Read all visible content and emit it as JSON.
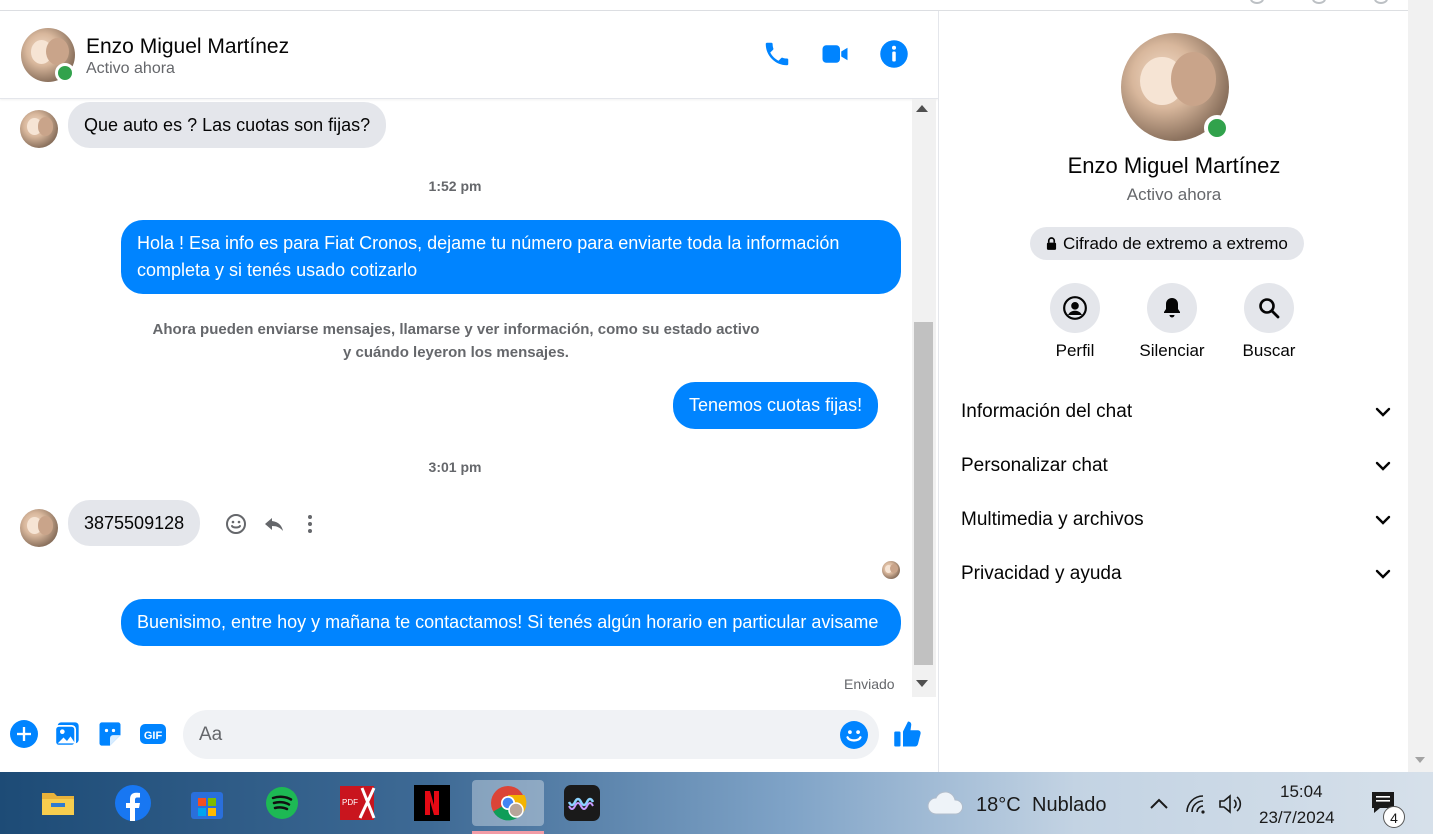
{
  "header": {
    "contact_name": "Enzo Miguel Martínez",
    "status": "Activo ahora"
  },
  "messages": {
    "incoming_1": "Que auto es ? Las cuotas son fijas?",
    "time_1": "1:52 pm",
    "outgoing_1": "Hola ! Esa info es para Fiat Cronos, dejame tu número para enviarte toda la información completa y si tenés usado cotizarlo",
    "notice_line_1": "Ahora pueden enviarse mensajes, llamarse y ver información, como su estado activo",
    "notice_line_2": "y cuándo leyeron los mensajes.",
    "outgoing_2": "Tenemos cuotas fijas!",
    "time_2": "3:01 pm",
    "incoming_2": "3875509128",
    "outgoing_3": "Buenisimo, entre hoy y mañana te contactamos! Si tenés algún horario en particular avisame",
    "sent_status": "Enviado"
  },
  "composer": {
    "placeholder": "Aa"
  },
  "panel": {
    "name": "Enzo Miguel Martínez",
    "status": "Activo ahora",
    "encryption": "Cifrado de extremo a extremo",
    "actions": [
      "Perfil",
      "Silenciar",
      "Buscar"
    ],
    "sections": [
      "Información del chat",
      "Personalizar chat",
      "Multimedia y archivos",
      "Privacidad y ayuda"
    ]
  },
  "taskbar": {
    "apps": [
      "file-explorer-icon",
      "facebook-icon",
      "microsoft-store-icon",
      "spotify-icon",
      "pdf-editor-icon",
      "netflix-icon",
      "chrome-icon",
      "waveform-app-icon"
    ],
    "weather_temp": "18°C",
    "weather_desc": "Nublado",
    "time": "15:04",
    "date": "23/7/2024",
    "notification_count": "4"
  },
  "colors": {
    "accent": "#0084ff",
    "incoming_bubble": "#e4e6eb",
    "online": "#31a24c"
  }
}
